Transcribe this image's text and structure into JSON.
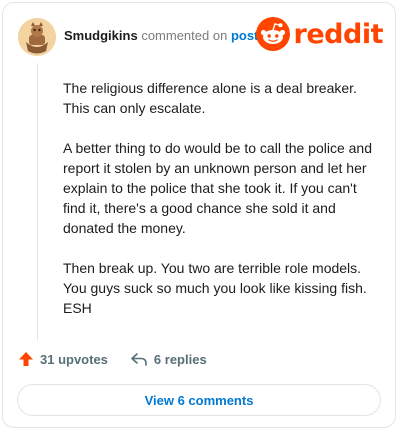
{
  "header": {
    "author": "Smudgikins",
    "action_text": "commented on",
    "post_link": "post",
    "brand": "reddit"
  },
  "comment": {
    "paragraphs": [
      "The religious difference alone is a deal breaker. This can only escalate.",
      "A better thing to do would be to call the police and report it stolen by an unknown person and let her explain to the police that she took it. If you can't find it, there's a good chance she sold it and donated the money.",
      "Then break up. You two are terrible role models. You guys suck so much you look like kissing fish. ESH"
    ]
  },
  "actions": {
    "upvotes": "31 upvotes",
    "replies": "6 replies"
  },
  "footer": {
    "view_comments": "View 6 comments"
  },
  "colors": {
    "brand": "#ff4500",
    "link": "#0079d3",
    "muted": "#576f76"
  },
  "icons": [
    "avatar-image",
    "reddit-snoo-icon",
    "upvote-arrow-icon",
    "reply-icon"
  ]
}
